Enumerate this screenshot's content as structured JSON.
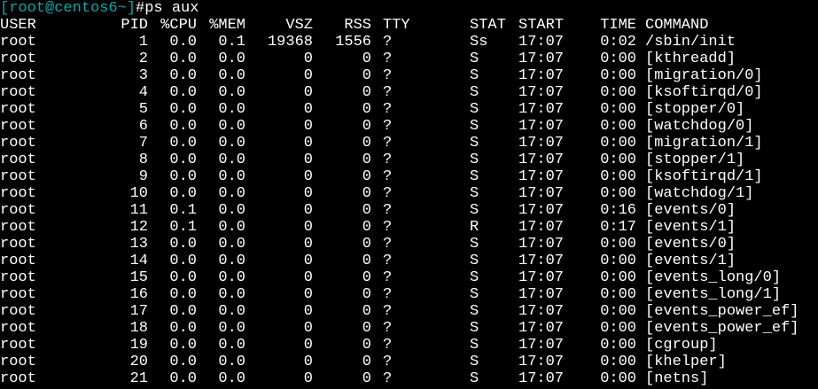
{
  "prompt": {
    "text": "[root@centos6~]",
    "symbol": "#",
    "command": "ps aux",
    "color": "#00aaaa"
  },
  "header": {
    "user": "USER",
    "pid": "PID",
    "cpu": "%CPU",
    "mem": "%MEM",
    "vsz": "VSZ",
    "rss": "RSS",
    "tty": "TTY",
    "stat": "STAT",
    "start": "START",
    "time": "TIME",
    "command": "COMMAND"
  },
  "rows": [
    {
      "user": "root",
      "pid": "1",
      "cpu": "0.0",
      "mem": "0.1",
      "vsz": "19368",
      "rss": "1556",
      "tty": "?",
      "stat": "Ss",
      "start": "17:07",
      "time": "0:02",
      "command": "/sbin/init"
    },
    {
      "user": "root",
      "pid": "2",
      "cpu": "0.0",
      "mem": "0.0",
      "vsz": "0",
      "rss": "0",
      "tty": "?",
      "stat": "S",
      "start": "17:07",
      "time": "0:00",
      "command": "[kthreadd]"
    },
    {
      "user": "root",
      "pid": "3",
      "cpu": "0.0",
      "mem": "0.0",
      "vsz": "0",
      "rss": "0",
      "tty": "?",
      "stat": "S",
      "start": "17:07",
      "time": "0:00",
      "command": "[migration/0]"
    },
    {
      "user": "root",
      "pid": "4",
      "cpu": "0.0",
      "mem": "0.0",
      "vsz": "0",
      "rss": "0",
      "tty": "?",
      "stat": "S",
      "start": "17:07",
      "time": "0:00",
      "command": "[ksoftirqd/0]"
    },
    {
      "user": "root",
      "pid": "5",
      "cpu": "0.0",
      "mem": "0.0",
      "vsz": "0",
      "rss": "0",
      "tty": "?",
      "stat": "S",
      "start": "17:07",
      "time": "0:00",
      "command": "[stopper/0]"
    },
    {
      "user": "root",
      "pid": "6",
      "cpu": "0.0",
      "mem": "0.0",
      "vsz": "0",
      "rss": "0",
      "tty": "?",
      "stat": "S",
      "start": "17:07",
      "time": "0:00",
      "command": "[watchdog/0]"
    },
    {
      "user": "root",
      "pid": "7",
      "cpu": "0.0",
      "mem": "0.0",
      "vsz": "0",
      "rss": "0",
      "tty": "?",
      "stat": "S",
      "start": "17:07",
      "time": "0:00",
      "command": "[migration/1]"
    },
    {
      "user": "root",
      "pid": "8",
      "cpu": "0.0",
      "mem": "0.0",
      "vsz": "0",
      "rss": "0",
      "tty": "?",
      "stat": "S",
      "start": "17:07",
      "time": "0:00",
      "command": "[stopper/1]"
    },
    {
      "user": "root",
      "pid": "9",
      "cpu": "0.0",
      "mem": "0.0",
      "vsz": "0",
      "rss": "0",
      "tty": "?",
      "stat": "S",
      "start": "17:07",
      "time": "0:00",
      "command": "[ksoftirqd/1]"
    },
    {
      "user": "root",
      "pid": "10",
      "cpu": "0.0",
      "mem": "0.0",
      "vsz": "0",
      "rss": "0",
      "tty": "?",
      "stat": "S",
      "start": "17:07",
      "time": "0:00",
      "command": "[watchdog/1]"
    },
    {
      "user": "root",
      "pid": "11",
      "cpu": "0.1",
      "mem": "0.0",
      "vsz": "0",
      "rss": "0",
      "tty": "?",
      "stat": "S",
      "start": "17:07",
      "time": "0:16",
      "command": "[events/0]"
    },
    {
      "user": "root",
      "pid": "12",
      "cpu": "0.1",
      "mem": "0.0",
      "vsz": "0",
      "rss": "0",
      "tty": "?",
      "stat": "R",
      "start": "17:07",
      "time": "0:17",
      "command": "[events/1]"
    },
    {
      "user": "root",
      "pid": "13",
      "cpu": "0.0",
      "mem": "0.0",
      "vsz": "0",
      "rss": "0",
      "tty": "?",
      "stat": "S",
      "start": "17:07",
      "time": "0:00",
      "command": "[events/0]"
    },
    {
      "user": "root",
      "pid": "14",
      "cpu": "0.0",
      "mem": "0.0",
      "vsz": "0",
      "rss": "0",
      "tty": "?",
      "stat": "S",
      "start": "17:07",
      "time": "0:00",
      "command": "[events/1]"
    },
    {
      "user": "root",
      "pid": "15",
      "cpu": "0.0",
      "mem": "0.0",
      "vsz": "0",
      "rss": "0",
      "tty": "?",
      "stat": "S",
      "start": "17:07",
      "time": "0:00",
      "command": "[events_long/0]"
    },
    {
      "user": "root",
      "pid": "16",
      "cpu": "0.0",
      "mem": "0.0",
      "vsz": "0",
      "rss": "0",
      "tty": "?",
      "stat": "S",
      "start": "17:07",
      "time": "0:00",
      "command": "[events_long/1]"
    },
    {
      "user": "root",
      "pid": "17",
      "cpu": "0.0",
      "mem": "0.0",
      "vsz": "0",
      "rss": "0",
      "tty": "?",
      "stat": "S",
      "start": "17:07",
      "time": "0:00",
      "command": "[events_power_ef]"
    },
    {
      "user": "root",
      "pid": "18",
      "cpu": "0.0",
      "mem": "0.0",
      "vsz": "0",
      "rss": "0",
      "tty": "?",
      "stat": "S",
      "start": "17:07",
      "time": "0:00",
      "command": "[events_power_ef]"
    },
    {
      "user": "root",
      "pid": "19",
      "cpu": "0.0",
      "mem": "0.0",
      "vsz": "0",
      "rss": "0",
      "tty": "?",
      "stat": "S",
      "start": "17:07",
      "time": "0:00",
      "command": "[cgroup]"
    },
    {
      "user": "root",
      "pid": "20",
      "cpu": "0.0",
      "mem": "0.0",
      "vsz": "0",
      "rss": "0",
      "tty": "?",
      "stat": "S",
      "start": "17:07",
      "time": "0:00",
      "command": "[khelper]"
    },
    {
      "user": "root",
      "pid": "21",
      "cpu": "0.0",
      "mem": "0.0",
      "vsz": "0",
      "rss": "0",
      "tty": "?",
      "stat": "S",
      "start": "17:07",
      "time": "0:00",
      "command": "[netns]"
    }
  ]
}
